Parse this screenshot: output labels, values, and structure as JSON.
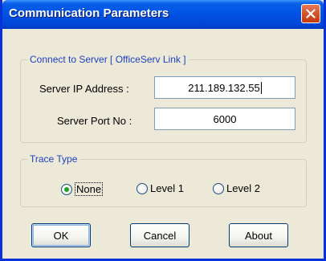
{
  "window": {
    "title": "Communication Parameters"
  },
  "server_group": {
    "label": "Connect to Server [ OfficeServ Link ]",
    "ip_label": "Server IP Address :",
    "ip_value": "211.189.132.55",
    "port_label": "Server Port No :",
    "port_value": "6000"
  },
  "trace_group": {
    "label": "Trace Type",
    "options": [
      {
        "label": "None",
        "selected": true
      },
      {
        "label": "Level 1",
        "selected": false
      },
      {
        "label": "Level 2",
        "selected": false
      }
    ]
  },
  "buttons": {
    "ok": "OK",
    "cancel": "Cancel",
    "about": "About"
  },
  "colors": {
    "titlebar": "#0055e5",
    "group_label": "#1e3fc1",
    "radio_selected": "#21a121",
    "close_button": "#d2542c"
  },
  "icons": {
    "close": "close-x-icon"
  }
}
